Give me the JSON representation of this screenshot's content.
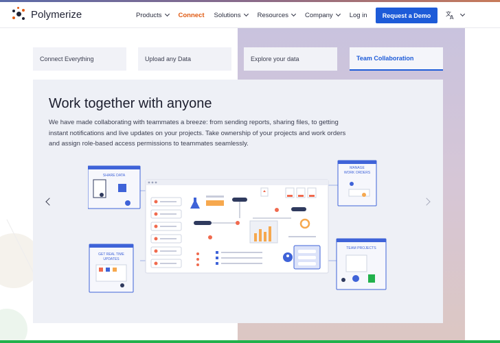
{
  "brand": {
    "name": "Polymerize"
  },
  "nav": {
    "items": [
      {
        "label": "Products",
        "has_menu": true
      },
      {
        "label": "Connect",
        "has_menu": false,
        "active": true
      },
      {
        "label": "Solutions",
        "has_menu": true
      },
      {
        "label": "Resources",
        "has_menu": true
      },
      {
        "label": "Company",
        "has_menu": true
      },
      {
        "label": "Log in",
        "has_menu": false
      }
    ],
    "cta_label": "Request a Demo",
    "language_icon": "translate-icon"
  },
  "tabs": [
    {
      "label": "Connect Everything",
      "active": false
    },
    {
      "label": "Upload any Data",
      "active": false
    },
    {
      "label": "Explore your data",
      "active": false
    },
    {
      "label": "Team Collaboration",
      "active": true
    }
  ],
  "feature": {
    "title": "Work together with anyone",
    "description": "We have made collaborating with teammates a breeze: from sending reports, sharing files, to getting instant notifications and live updates on your projects. Take ownership of your projects and work orders and assign role-based access permissions to teammates seamlessly.",
    "illustration": {
      "share_data": "SHARE DATA",
      "manage_work_orders": "MANAGE WORK ORDERS",
      "real_time_updates": "GET REAL TIME UPDATES",
      "team_projects": "TEAM PROJECTS"
    }
  },
  "colors": {
    "accent": "#1d5bd8",
    "active_nav": "#e05a12",
    "card_bg": "#eef0f6",
    "illustration_blue": "#3f63d8"
  }
}
